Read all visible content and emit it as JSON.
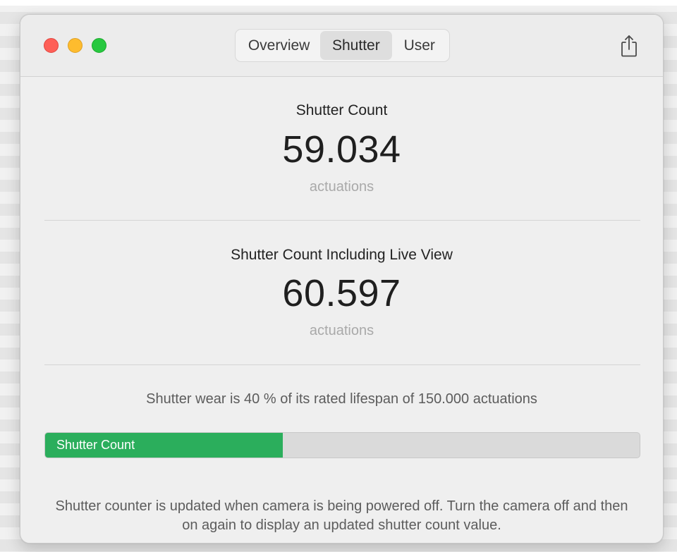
{
  "window": {
    "controls": {
      "close": "close-button",
      "minimize": "minimize-button",
      "zoom": "zoom-button"
    },
    "tabs": [
      {
        "label": "Overview",
        "selected": false
      },
      {
        "label": "Shutter",
        "selected": true
      },
      {
        "label": "User",
        "selected": false
      }
    ],
    "share_icon": "share-icon"
  },
  "shutter_count": {
    "title": "Shutter Count",
    "value": "59.034",
    "unit": "actuations"
  },
  "shutter_count_live_view": {
    "title": "Shutter Count Including Live View",
    "value": "60.597",
    "unit": "actuations"
  },
  "wear": {
    "text": "Shutter wear is 40 % of its rated lifespan of 150.000 actuations",
    "percent": 40,
    "bar_label": "Shutter Count",
    "bar_color": "#2bae5c"
  },
  "note": {
    "text": "Shutter counter is updated when camera is being powered off. Turn the camera off and then on again to display an updated shutter count value."
  }
}
